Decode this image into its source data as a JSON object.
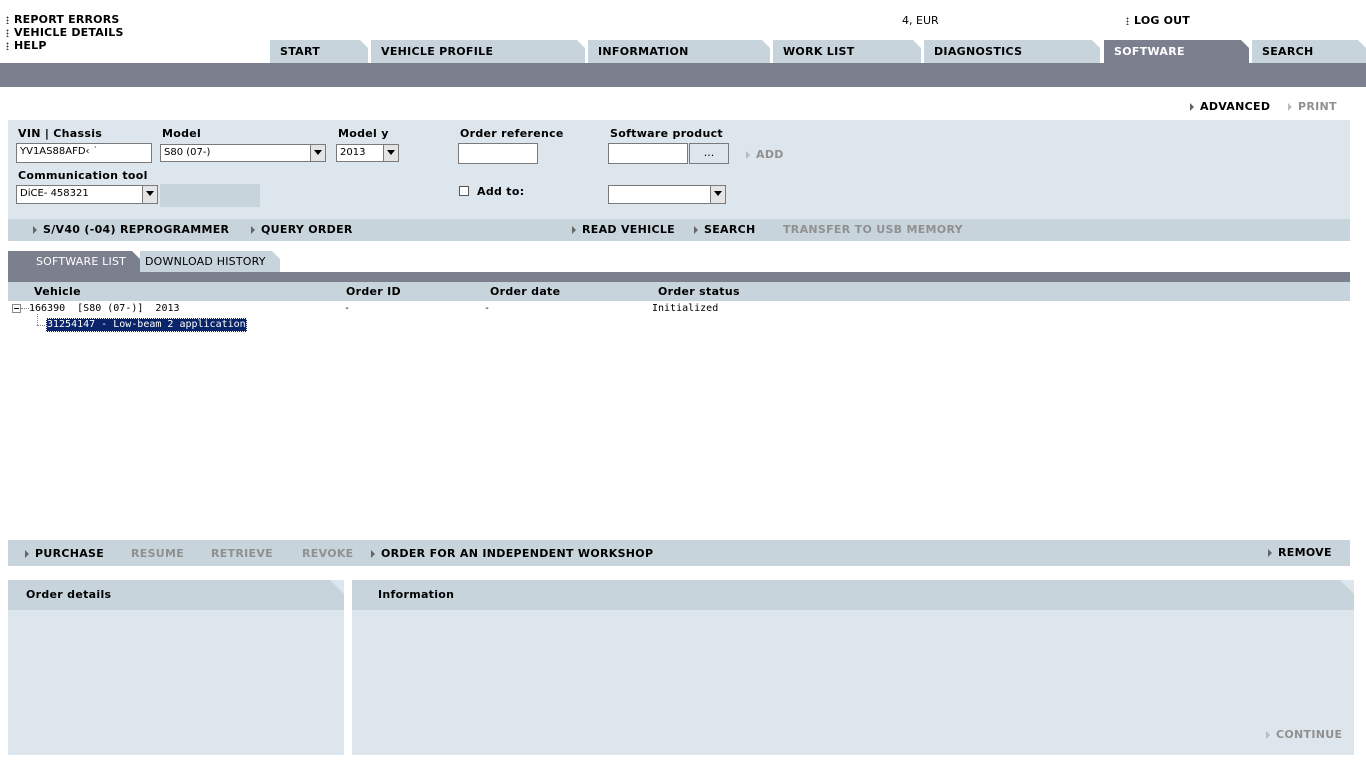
{
  "top_links": {
    "report_errors": "REPORT ERRORS",
    "vehicle_details": "VEHICLE DETAILS",
    "help": "HELP",
    "currency": "4, EUR",
    "log_out": "LOG OUT"
  },
  "nav_tabs": [
    {
      "label": "START"
    },
    {
      "label": "VEHICLE PROFILE"
    },
    {
      "label": "INFORMATION"
    },
    {
      "label": "WORK LIST"
    },
    {
      "label": "DIAGNOSTICS"
    },
    {
      "label": "SOFTWARE",
      "active": true
    },
    {
      "label": "SEARCH"
    }
  ],
  "utility": {
    "advanced": "ADVANCED",
    "print": "PRINT"
  },
  "form": {
    "vin_label": "VIN | Chassis",
    "vin_value": "YV1AS88AFD‹ ˙",
    "model_label": "Model",
    "model_value": "S80 (07-)",
    "model_year_label": "Model y",
    "model_year_value": "2013",
    "order_ref_label": "Order reference",
    "order_ref_value": "",
    "software_product_label": "Software product",
    "software_product_value": "",
    "browse_label": "...",
    "add_label": "ADD",
    "comm_tool_label": "Communication tool",
    "comm_tool_value": "DiCE- 458321",
    "add_to_label": "Add to:",
    "add_to_value": ""
  },
  "action_bar": {
    "reprogrammer": "S/V40 (-04) REPROGRAMMER",
    "query_order": "QUERY ORDER",
    "read_vehicle": "READ VEHICLE",
    "search": "SEARCH",
    "transfer_usb": "TRANSFER TO USB MEMORY"
  },
  "sub_tabs": {
    "software_list": "SOFTWARE LIST",
    "download_history": "DOWNLOAD HISTORY"
  },
  "table": {
    "columns": [
      "Vehicle",
      "Order ID",
      "Order date",
      "Order status"
    ],
    "rows": [
      {
        "vehicle": "166390  [S80 (07-)]  2013",
        "order_id": "-",
        "order_date": "-",
        "order_status": "Initialized",
        "children": [
          {
            "label": "31254147 - Low-beam 2 application"
          }
        ]
      }
    ]
  },
  "bottom_bar": {
    "purchase": "PURCHASE",
    "resume": "RESUME",
    "retrieve": "RETRIEVE",
    "revoke": "REVOKE",
    "order_independent": "ORDER FOR AN INDEPENDENT WORKSHOP",
    "remove": "REMOVE"
  },
  "panels": {
    "order_details": "Order details",
    "information": "Information",
    "continue": "CONTINUE"
  }
}
